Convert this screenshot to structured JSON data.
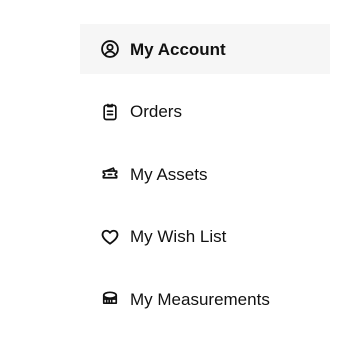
{
  "account_menu": {
    "items": [
      {
        "label": "My Account",
        "icon": "user-circle-icon",
        "active": true
      },
      {
        "label": "Orders",
        "icon": "clipboard-icon",
        "active": false
      },
      {
        "label": "My Assets",
        "icon": "ticket-icon",
        "active": false
      },
      {
        "label": "My Wish List",
        "icon": "heart-icon",
        "active": false
      },
      {
        "label": "My Measurements",
        "icon": "measure-icon",
        "active": false
      }
    ]
  }
}
